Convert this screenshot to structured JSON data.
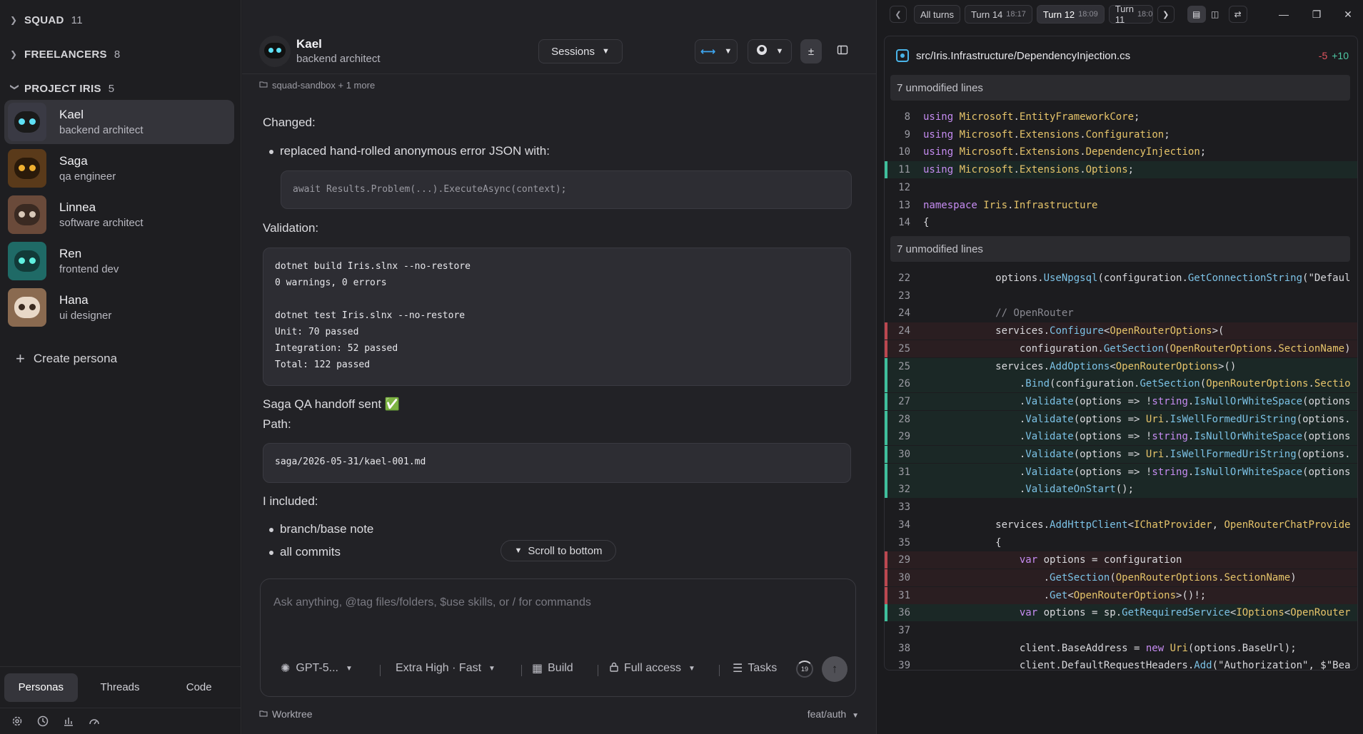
{
  "sidebar": {
    "groups": [
      {
        "label": "SQUAD",
        "count": "11"
      },
      {
        "label": "FREELANCERS",
        "count": "8"
      },
      {
        "label": "PROJECT IRIS",
        "count": "5"
      }
    ],
    "personas": [
      {
        "name": "Kael",
        "role": "backend architect"
      },
      {
        "name": "Saga",
        "role": "qa engineer"
      },
      {
        "name": "Linnea",
        "role": "software architect"
      },
      {
        "name": "Ren",
        "role": "frontend dev"
      },
      {
        "name": "Hana",
        "role": "ui designer"
      }
    ],
    "create_label": "Create persona",
    "tabs": [
      "Personas",
      "Threads",
      "Code"
    ]
  },
  "chat": {
    "name": "Kael",
    "role": "backend architect",
    "sessions_label": "Sessions",
    "workspace": "squad-sandbox + 1 more",
    "changed_heading": "Changed:",
    "changed_bullet": "replaced hand-rolled anonymous error JSON with:",
    "code1": "await Results.Problem(...).ExecuteAsync(context);",
    "validation_heading": "Validation:",
    "code2": "dotnet build Iris.slnx --no-restore\n0 warnings, 0 errors\n\ndotnet test Iris.slnx --no-restore\nUnit: 70 passed\nIntegration: 52 passed\nTotal: 122 passed",
    "handoff": "Saga QA handoff sent ✅",
    "path_heading": "Path:",
    "code3": "saga/2026-05-31/kael-001.md",
    "included_heading": "I included:",
    "included": [
      "branch/base note",
      "all commits"
    ],
    "scroll_label": "Scroll to bottom",
    "input_placeholder": "Ask anything, @tag files/folders, $use skills, or / for commands",
    "model": "GPT-5...",
    "effort": "Extra High · Fast",
    "mode": "Build",
    "access": "Full access",
    "tasks": "Tasks",
    "tasks_count": "19",
    "footer_label": "Worktree",
    "branch": "feat/auth"
  },
  "diff": {
    "turns": [
      {
        "label": "All turns",
        "time": ""
      },
      {
        "label": "Turn 14",
        "time": "18:17"
      },
      {
        "label": "Turn 12",
        "time": "18:09"
      },
      {
        "label": "Turn 11",
        "time": "18:0"
      }
    ],
    "file": "src/Iris.Infrastructure/DependencyInjection.cs",
    "deletions": "-5",
    "additions": "+10",
    "unmodified1": "7 unmodified lines",
    "unmodified2": "7 unmodified lines",
    "lines_a": [
      {
        "n": "8",
        "t": "using Microsoft.EntityFrameworkCore;",
        "k": ""
      },
      {
        "n": "9",
        "t": "using Microsoft.Extensions.Configuration;",
        "k": ""
      },
      {
        "n": "10",
        "t": "using Microsoft.Extensions.DependencyInjection;",
        "k": ""
      },
      {
        "n": "11",
        "t": "using Microsoft.Extensions.Options;",
        "k": "add"
      },
      {
        "n": "12",
        "t": "",
        "k": ""
      },
      {
        "n": "13",
        "t": "namespace Iris.Infrastructure",
        "k": ""
      },
      {
        "n": "14",
        "t": "{",
        "k": ""
      }
    ],
    "lines_b": [
      {
        "n": "22",
        "t": "            options.UseNpgsql(configuration.GetConnectionString(\"Defaul",
        "k": ""
      },
      {
        "n": "23",
        "t": "",
        "k": ""
      },
      {
        "n": "24",
        "t": "            // OpenRouter",
        "k": ""
      },
      {
        "n": "24",
        "t": "            services.Configure<OpenRouterOptions>(",
        "k": "del"
      },
      {
        "n": "25",
        "t": "                configuration.GetSection(OpenRouterOptions.SectionName)",
        "k": "del"
      },
      {
        "n": "25",
        "t": "            services.AddOptions<OpenRouterOptions>()",
        "k": "add"
      },
      {
        "n": "26",
        "t": "                .Bind(configuration.GetSection(OpenRouterOptions.Sectio",
        "k": "add"
      },
      {
        "n": "27",
        "t": "                .Validate(options => !string.IsNullOrWhiteSpace(options",
        "k": "add"
      },
      {
        "n": "28",
        "t": "                .Validate(options => Uri.IsWellFormedUriString(options.",
        "k": "add"
      },
      {
        "n": "29",
        "t": "                .Validate(options => !string.IsNullOrWhiteSpace(options",
        "k": "add"
      },
      {
        "n": "30",
        "t": "                .Validate(options => Uri.IsWellFormedUriString(options.",
        "k": "add"
      },
      {
        "n": "31",
        "t": "                .Validate(options => !string.IsNullOrWhiteSpace(options",
        "k": "add"
      },
      {
        "n": "32",
        "t": "                .ValidateOnStart();",
        "k": "add"
      },
      {
        "n": "33",
        "t": "",
        "k": ""
      },
      {
        "n": "34",
        "t": "            services.AddHttpClient<IChatProvider, OpenRouterChatProvide",
        "k": ""
      },
      {
        "n": "35",
        "t": "            {",
        "k": ""
      },
      {
        "n": "29",
        "t": "                var options = configuration",
        "k": "del"
      },
      {
        "n": "30",
        "t": "                    .GetSection(OpenRouterOptions.SectionName)",
        "k": "del"
      },
      {
        "n": "31",
        "t": "                    .Get<OpenRouterOptions>()!;",
        "k": "del"
      },
      {
        "n": "36",
        "t": "                var options = sp.GetRequiredService<IOptions<OpenRouter",
        "k": "add"
      },
      {
        "n": "37",
        "t": "",
        "k": ""
      },
      {
        "n": "38",
        "t": "                client.BaseAddress = new Uri(options.BaseUrl);",
        "k": ""
      },
      {
        "n": "39",
        "t": "                client.DefaultRequestHeaders.Add(\"Authorization\", $\"Bea",
        "k": ""
      }
    ]
  }
}
